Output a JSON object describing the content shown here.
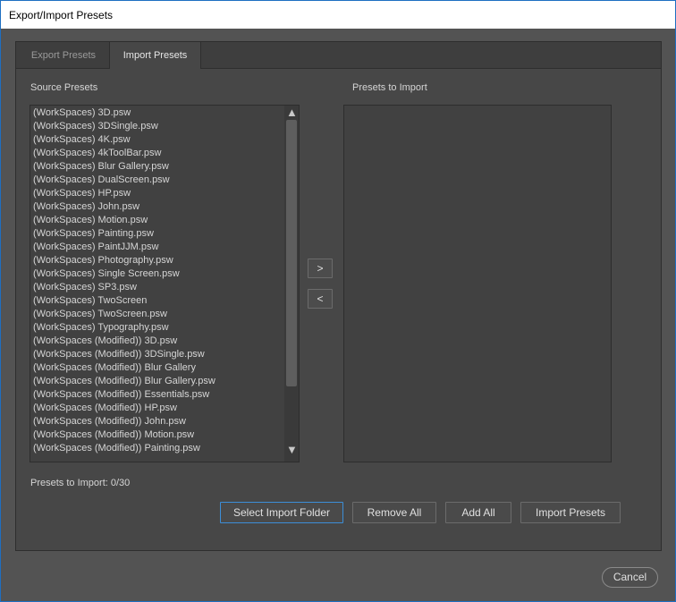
{
  "window": {
    "title": "Export/Import Presets"
  },
  "tabs": [
    {
      "label": "Export Presets"
    },
    {
      "label": "Import Presets"
    }
  ],
  "source": {
    "label": "Source Presets",
    "items": [
      "(WorkSpaces)  3D.psw",
      "(WorkSpaces)  3DSingle.psw",
      "(WorkSpaces)  4K.psw",
      "(WorkSpaces)  4kToolBar.psw",
      "(WorkSpaces)  Blur Gallery.psw",
      "(WorkSpaces)  DualScreen.psw",
      "(WorkSpaces)  HP.psw",
      "(WorkSpaces)  John.psw",
      "(WorkSpaces)  Motion.psw",
      "(WorkSpaces)  Painting.psw",
      "(WorkSpaces)  PaintJJM.psw",
      "(WorkSpaces)  Photography.psw",
      "(WorkSpaces)  Single Screen.psw",
      "(WorkSpaces)  SP3.psw",
      "(WorkSpaces)  TwoScreen",
      "(WorkSpaces)  TwoScreen.psw",
      "(WorkSpaces)  Typography.psw",
      "(WorkSpaces (Modified))  3D.psw",
      "(WorkSpaces (Modified))  3DSingle.psw",
      "(WorkSpaces (Modified))  Blur Gallery",
      "(WorkSpaces (Modified))  Blur Gallery.psw",
      "(WorkSpaces (Modified))  Essentials.psw",
      "(WorkSpaces (Modified))  HP.psw",
      "(WorkSpaces (Modified))  John.psw",
      "(WorkSpaces (Modified))  Motion.psw",
      "(WorkSpaces (Modified))  Painting.psw"
    ]
  },
  "target": {
    "label": "Presets to Import"
  },
  "arrows": {
    "add": ">",
    "remove": "<"
  },
  "status": {
    "count_text": "Presets to Import: 0/30"
  },
  "buttons": {
    "select_folder": "Select Import Folder",
    "remove_all": "Remove All",
    "add_all": "Add All",
    "import": "Import Presets",
    "cancel": "Cancel"
  },
  "icons": {
    "scroll_up": "triangle-up",
    "scroll_down": "triangle-down"
  }
}
